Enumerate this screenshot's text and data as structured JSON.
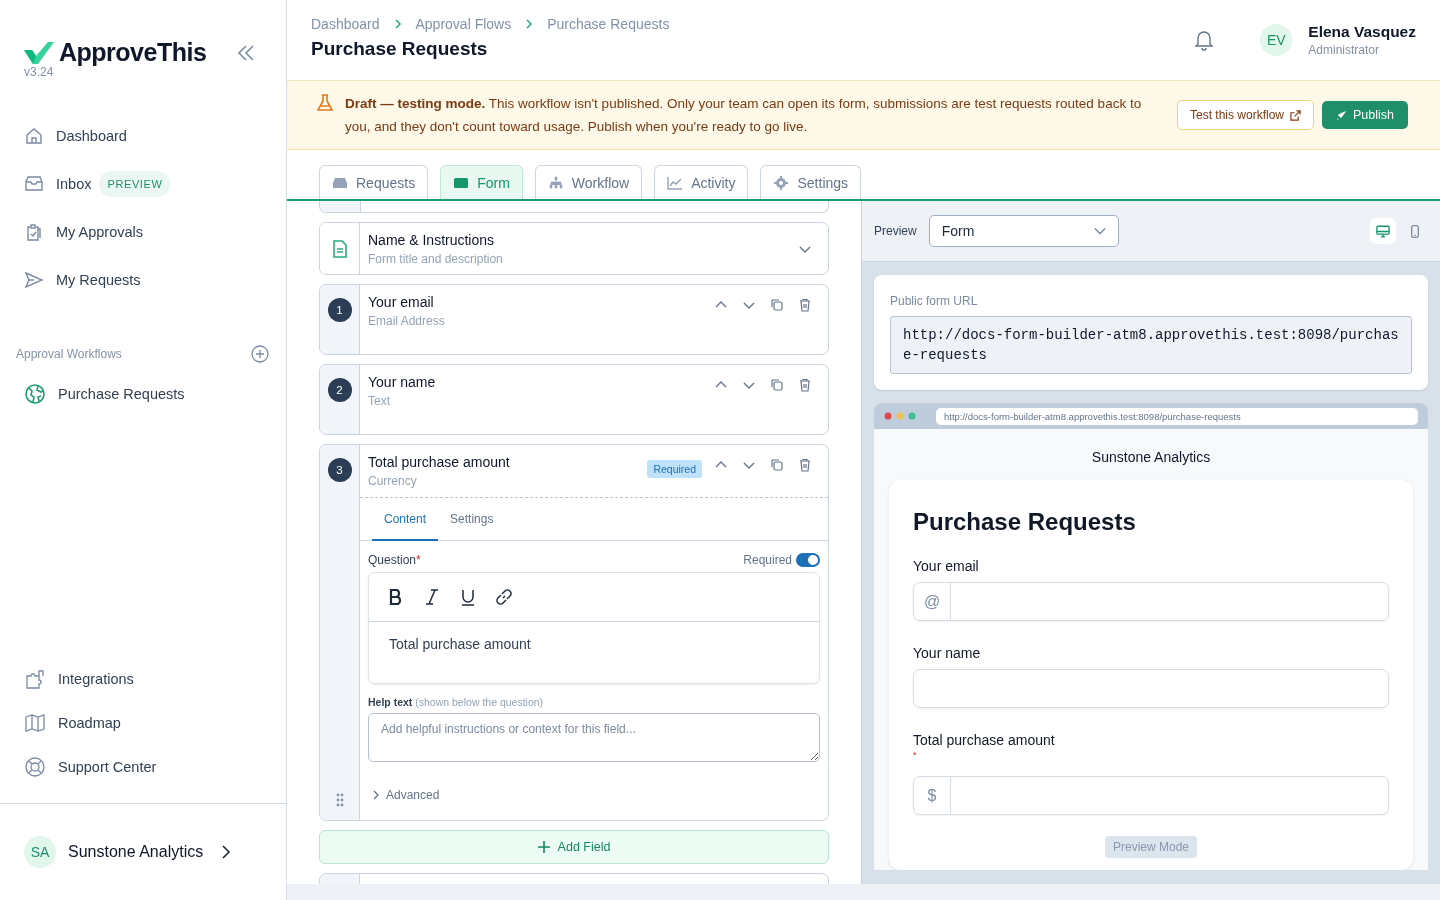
{
  "sidebar": {
    "logo": "ApproveThis",
    "version": "v3.24",
    "nav": [
      {
        "label": "Dashboard",
        "selected": false
      },
      {
        "label": "Inbox",
        "badge": "PREVIEW",
        "selected": false
      },
      {
        "label": "My Approvals",
        "selected": false
      },
      {
        "label": "My Requests",
        "selected": false
      }
    ],
    "section": "Approval Workflows",
    "workflows": [
      {
        "label": "Purchase Requests",
        "selected": false
      }
    ],
    "bottom_nav": [
      {
        "label": "Integrations"
      },
      {
        "label": "Roadmap"
      },
      {
        "label": "Support Center"
      }
    ],
    "org": {
      "initials": "SA",
      "name": "Sunstone Analytics"
    }
  },
  "header": {
    "breadcrumbs": [
      "Dashboard",
      "Approval Flows",
      "Purchase Requests"
    ],
    "title": "Purchase Requests",
    "user": {
      "initials": "EV",
      "name": "Elena Vasquez",
      "role": "Administrator"
    }
  },
  "banner": {
    "text": "**Draft — testing mode.** This workflow isn't published. Only your team can open its form, submissions are test requests routed back to you, and they don't count toward usage. Publish when you're ready to go live.",
    "test_button": "Test this workflow",
    "publish_button": "Publish"
  },
  "tabs": [
    {
      "label": "Requests",
      "selected": false
    },
    {
      "label": "Form",
      "selected": true
    },
    {
      "label": "Workflow",
      "selected": false
    },
    {
      "label": "Activity",
      "selected": false
    },
    {
      "label": "Settings",
      "selected": false
    }
  ],
  "editor": {
    "intro": {
      "title": "Name & Instructions",
      "subtitle": "Form title and description",
      "expanded": false
    },
    "fields": [
      {
        "number": "1",
        "title": "Your email",
        "type": "Email Address",
        "required": false,
        "expanded": false
      },
      {
        "number": "2",
        "title": "Your name",
        "type": "Text",
        "required": false,
        "expanded": false
      },
      {
        "number": "3",
        "title": "Total purchase amount",
        "type": "Currency",
        "required": true,
        "required_badge": "Required",
        "expanded": true,
        "subtabs": [
          {
            "label": "Content",
            "selected": true
          },
          {
            "label": "Settings",
            "selected": false
          }
        ],
        "question_label": "Question",
        "question_mark": "*",
        "toggle": {
          "label": "Required",
          "on": true
        },
        "question": "Total purchase amount",
        "help_label": "Help text",
        "help_hint": "(shown below the question)",
        "help_placeholder": "Add helpful instructions or context for this field...",
        "advanced": "Advanced"
      }
    ],
    "add_field": "Add Field"
  },
  "preview": {
    "label": "Preview",
    "mode": "Form",
    "devices": [
      {
        "selected": true
      },
      {
        "selected": false
      }
    ],
    "url_label": "Public form URL",
    "url": "http://docs-form-builder-atm8.approvethis.test:8098/purchase-requests",
    "browser_url": "http://docs-form-builder-atm8.approvethis.test:8098/purchase-requests",
    "org": "Sunstone Analytics",
    "form_title": "Purchase Requests",
    "fields": [
      {
        "label": "Your email",
        "required": false,
        "prefix": "@"
      },
      {
        "label": "Your name",
        "required": false
      },
      {
        "label": "Total purchase amount",
        "required": true,
        "required_mark": "*",
        "prefix": "$"
      }
    ],
    "button": "Preview Mode"
  }
}
